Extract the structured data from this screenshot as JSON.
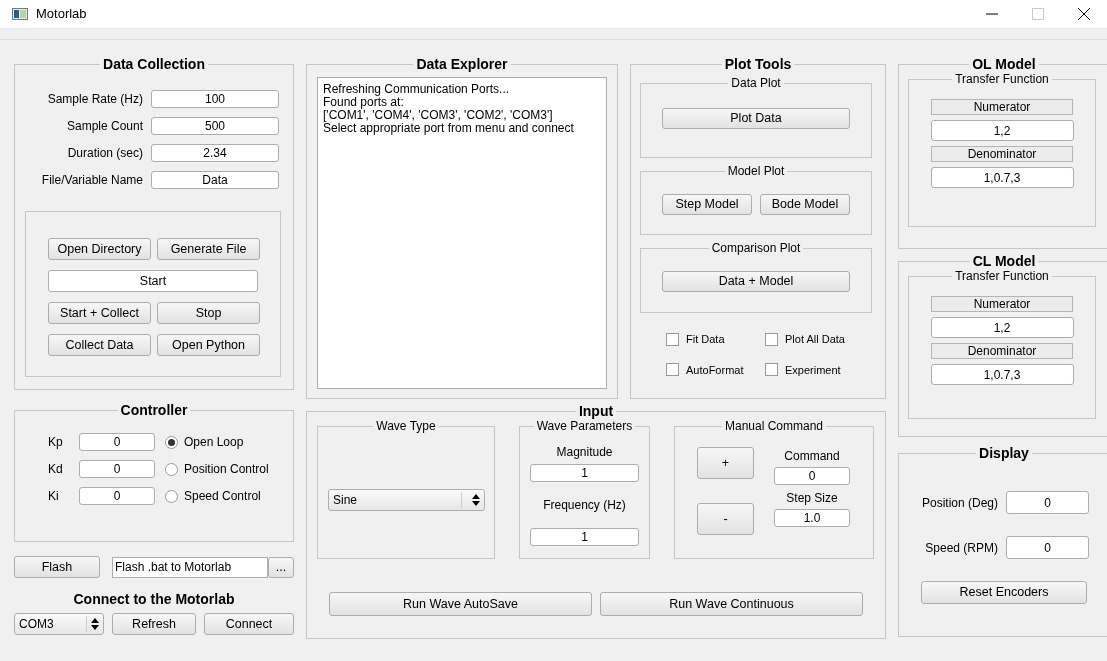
{
  "window": {
    "title": "Motorlab"
  },
  "data_collection": {
    "title": "Data Collection",
    "fields": [
      {
        "label": "Sample Rate (Hz)",
        "value": "100"
      },
      {
        "label": "Sample Count",
        "value": "500"
      },
      {
        "label": "Duration (sec)",
        "value": "2.34"
      },
      {
        "label": "File/Variable Name",
        "value": "Data"
      }
    ],
    "buttons": [
      {
        "label": "Open Directory",
        "kind": "half"
      },
      {
        "label": "Generate File",
        "kind": "half"
      },
      {
        "label": "Start",
        "kind": "wide"
      },
      {
        "label": "Start + Collect",
        "kind": "half"
      },
      {
        "label": "Stop",
        "kind": "half"
      },
      {
        "label": "Collect Data",
        "kind": "half"
      },
      {
        "label": "Open Python",
        "kind": "half"
      }
    ]
  },
  "controller": {
    "title": "Controller",
    "gains": [
      {
        "label": "Kp",
        "value": "0"
      },
      {
        "label": "Kd",
        "value": "0"
      },
      {
        "label": "Ki",
        "value": "0"
      }
    ],
    "modes": [
      {
        "label": "Open Loop",
        "selected": true
      },
      {
        "label": "Position Control",
        "selected": false
      },
      {
        "label": "Speed Control",
        "selected": false
      }
    ]
  },
  "flash": {
    "button": "Flash",
    "path": "Flash .bat to Motorlab",
    "browse": "..."
  },
  "connect": {
    "title": "Connect to the Motorlab",
    "port": "COM3",
    "buttons": [
      "Refresh",
      "Connect"
    ]
  },
  "data_explorer": {
    "title": "Data Explorer",
    "lines": [
      "Refreshing Communication Ports...",
      "Found ports at:",
      "['COM1', 'COM4', 'COM3', 'COM2', 'COM3']",
      "Select appropriate port from menu and connect"
    ]
  },
  "plot_tools": {
    "title": "Plot Tools",
    "groups": [
      {
        "title": "Data Plot",
        "buttons": [
          "Plot Data"
        ]
      },
      {
        "title": "Model Plot",
        "buttons": [
          "Step Model",
          "Bode Model"
        ]
      },
      {
        "title": "Comparison Plot",
        "buttons": [
          "Data + Model"
        ]
      }
    ],
    "options": [
      {
        "label": "Fit Data",
        "checked": false
      },
      {
        "label": "Plot All Data",
        "checked": false
      },
      {
        "label": "AutoFormat",
        "checked": false
      },
      {
        "label": "Experiment",
        "checked": false
      }
    ]
  },
  "input": {
    "title": "Input",
    "wave_type": {
      "title": "Wave Type",
      "value": "Sine"
    },
    "wave_parameters": {
      "title": "Wave Parameters",
      "fields": [
        {
          "label": "Magnitude",
          "value": "1"
        },
        {
          "label": "Frequency (Hz)",
          "value": "1"
        }
      ]
    },
    "manual_command": {
      "title": "Manual Command",
      "buttons": [
        "+",
        "-"
      ],
      "fields": [
        {
          "label": "Command",
          "value": "0"
        },
        {
          "label": "Step Size",
          "value": "1.0"
        }
      ]
    },
    "buttons": [
      "Run Wave AutoSave",
      "Run Wave Continuous"
    ]
  },
  "models": [
    {
      "title": "OL Model",
      "subtitle": "Transfer Function",
      "numerator_label": "Numerator",
      "numerator": "1,2",
      "denominator_label": "Denominator",
      "denominator": "1,0.7,3"
    },
    {
      "title": "CL Model",
      "subtitle": "Transfer Function",
      "numerator_label": "Numerator",
      "numerator": "1,2",
      "denominator_label": "Denominator",
      "denominator": "1,0.7,3"
    }
  ],
  "display": {
    "title": "Display",
    "fields": [
      {
        "label": "Position (Deg)",
        "value": "0"
      },
      {
        "label": "Speed (RPM)",
        "value": "0"
      }
    ],
    "button": "Reset Encoders"
  }
}
